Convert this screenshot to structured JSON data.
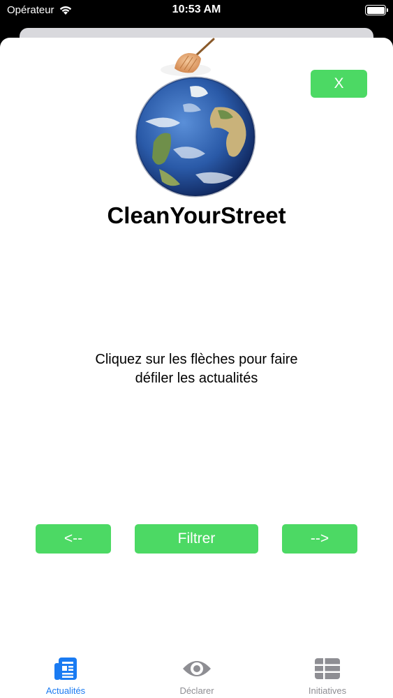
{
  "status_bar": {
    "carrier": "Opérateur",
    "time": "10:53 AM",
    "battery_level": 1.0
  },
  "header": {
    "close_label": "X",
    "app_title": "CleanYourStreet",
    "logo_icon": "earth-with-broom-icon"
  },
  "main": {
    "message_line1": "Cliquez sur les flèches pour faire",
    "message_line2": "défiler les actualités"
  },
  "controls": {
    "prev_label": "<--",
    "filter_label": "Filtrer",
    "next_label": "-->"
  },
  "tabs": [
    {
      "label": "Actualités",
      "icon": "newspaper-icon",
      "selected": true
    },
    {
      "label": "Déclarer",
      "icon": "eye-icon",
      "selected": false
    },
    {
      "label": "Initiatives",
      "icon": "table-grid-icon",
      "selected": false
    }
  ],
  "colors": {
    "accent_green": "#4cd964",
    "tab_active": "#1a7bf2",
    "tab_inactive": "#8e8e93"
  }
}
